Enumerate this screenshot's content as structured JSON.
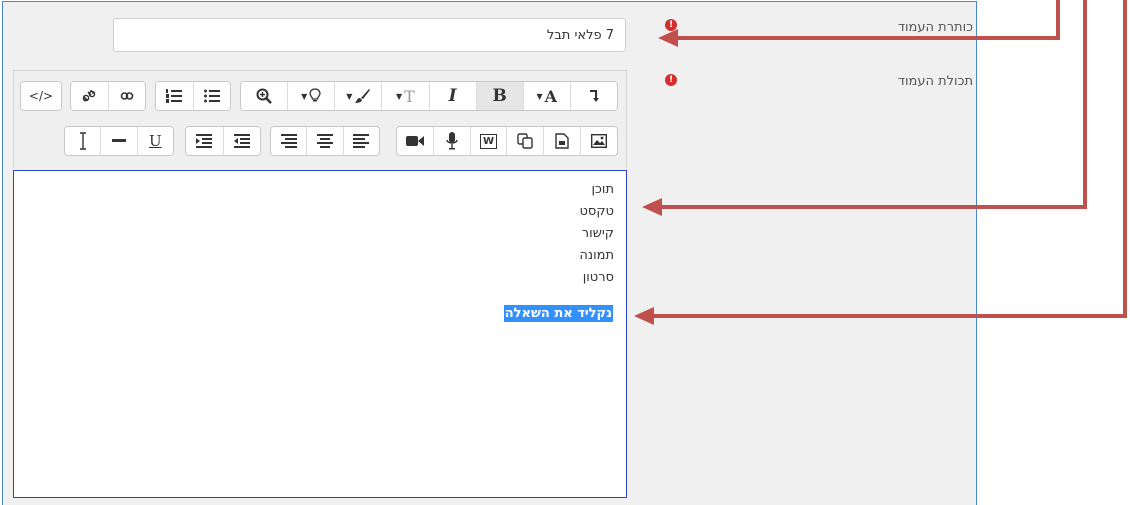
{
  "form": {
    "title_label": "כותרת העמוד",
    "content_label": "תכולת העמוד",
    "error_glyph": "!",
    "title_value": "7 פלאי תבל"
  },
  "toolbar": {
    "row1": {
      "html_glyph": "</>",
      "unlink_icon": "unlink-icon",
      "link_icon": "link-icon",
      "ordered_list_icon": "ordered-list-icon",
      "unordered_list_icon": "unordered-list-icon",
      "zoom_icon": "zoom-icon",
      "lightbulb_icon": "lightbulb-icon",
      "brush_icon": "brush-icon",
      "font_size_glyph": "T",
      "italic_label": "I",
      "bold_label": "B",
      "font_color_label": "A",
      "rtl_icon": "rtl-icon"
    },
    "row2": {
      "clear_format_icon": "clear-format-icon",
      "hr_icon": "horizontal-rule-icon",
      "underline_label": "U",
      "indent_icon": "indent-icon",
      "outdent_icon": "outdent-icon",
      "align_right_icon": "align-right-icon",
      "align_center_icon": "align-center-icon",
      "align_left_icon": "align-left-icon",
      "video_icon": "video-icon",
      "mic_icon": "mic-icon",
      "word_glyph": "W",
      "paste_icon": "paste-icon",
      "file_icon": "file-icon",
      "image_icon": "image-icon"
    }
  },
  "editor": {
    "lines": [
      "תוכן",
      "טקסט",
      "קישור",
      "תמונה",
      "סרטון"
    ],
    "selected_text": "נקליד את השאלה"
  },
  "colors": {
    "panel_bg": "#f0f0f0",
    "panel_border": "#4a86c5",
    "editor_border": "#2e3fbf",
    "error_red": "#d32f2f",
    "selection_blue": "#3391ff",
    "annotation_arrow": "#c0504d"
  }
}
